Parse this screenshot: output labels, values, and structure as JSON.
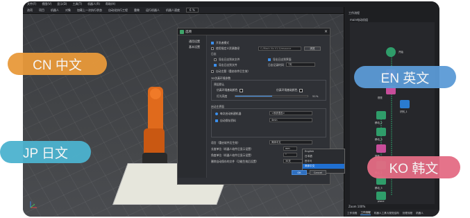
{
  "menubar": {
    "items": [
      "文件(F)",
      "视图(V)",
      "显示(D)",
      "工具(T)",
      "机器人(R)",
      "帮助(H)"
    ]
  },
  "toolbar": {
    "items": [
      "选项",
      "项目",
      "机器人",
      "对象",
      "加载上一次执行状态",
      "自动化执行工程",
      "重做",
      "运行机器人",
      "机器人速度"
    ],
    "zoom": "6 %"
  },
  "right_panel": {
    "title": "工作流程",
    "subtitle": "main电动机组",
    "nodes": [
      "开始",
      "相机",
      "视觉",
      "识别_1",
      "移动_2",
      "移动_3",
      "视觉",
      "移动_4",
      "移动_5",
      "plane"
    ],
    "zoom": "Zoom 100%",
    "tabs": [
      "工作流程",
      "工作流程",
      "机器人工具与视觉结构",
      "处理流程",
      "机器人"
    ],
    "active_tab": 1
  },
  "dialog": {
    "title": "选项",
    "left_menu": [
      "通用设置",
      "基本设置"
    ],
    "dev_mode": "开发者模式",
    "use_custom_path": "使用指定义资源路径",
    "path_value": "C:/Mech Viz V1.5/resource",
    "browse": "浏览",
    "log_label": "日志",
    "log_opt1": "导出日志到本文件",
    "log_opt2": "导出日志到界面",
    "log_opt3": "导出日志到文件",
    "log_interval_label": "日志记录时间",
    "log_interval_value": "7天",
    "auto_save": "自动主题（重启软件后生效）",
    "render_section": "3D仿真环境参数",
    "preset": "预设默认",
    "bg_color_label": "仿真环境基础颜色",
    "grid_color_label": "仿真环境基础颜色",
    "light_label": "灯光亮度",
    "light_value": "51%",
    "light_fraction": 0.51,
    "startup_label": "启动主界面",
    "startup_opt1": "每次启动新建机器",
    "startup_opt1_value": "<系统语言>",
    "auto_backup": "自动保存资料",
    "auto_backup_value": "4min",
    "language_label": "语言（重启软件后生效）",
    "language_value": "简体中文",
    "dropdown_options": [
      "English",
      "日本語",
      "한국어",
      "简体中文"
    ],
    "dropdown_selected": 3,
    "robot_bank_label": "长度单位（机器人软件后显示设置）",
    "robot_bank_value": "mm",
    "angle_label": "角度单位（机器人软件后显示设置）",
    "angle_value": "°",
    "delete_label": "删除自动保存的文件（功能生效后设置）",
    "delete_value": "30天",
    "ok": "OK",
    "cancel": "Cancel"
  },
  "annotations": {
    "cn": "CN 中文",
    "jp": "JP 日文",
    "en": "EN 英文",
    "ko": "KO 韩文"
  },
  "colors": {
    "cn_pill": "#e8993a",
    "jp_pill": "#4cb3cf",
    "en_pill": "#5b9ad6",
    "ko_pill": "#e46c84",
    "accent": "#3b8eea",
    "robot_orange": "#e06a1c"
  }
}
